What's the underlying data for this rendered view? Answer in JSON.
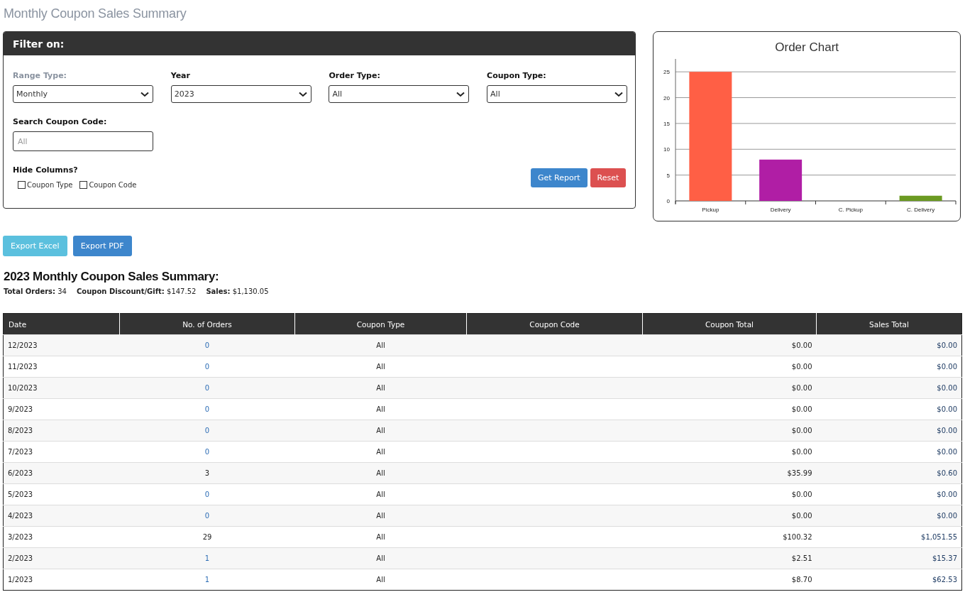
{
  "page_title": "Monthly Coupon Sales Summary",
  "filter": {
    "title": "Filter on:",
    "selects": [
      {
        "label": "Range Type:",
        "dimmed": true,
        "value": "Monthly"
      },
      {
        "label": "Year",
        "dimmed": false,
        "value": "2023"
      },
      {
        "label": "Order Type:",
        "dimmed": false,
        "value": "All"
      },
      {
        "label": "Coupon Type:",
        "dimmed": false,
        "value": "All"
      }
    ],
    "search": {
      "label": "Search Coupon Code:",
      "placeholder": "All"
    },
    "hide_columns": {
      "label": "Hide Columns?",
      "options": [
        {
          "label": "Coupon Type",
          "checked": false
        },
        {
          "label": "Coupon Code",
          "checked": false
        }
      ]
    },
    "buttons": [
      {
        "label": "Get Report",
        "kind": "primary"
      },
      {
        "label": "Reset",
        "kind": "danger"
      }
    ]
  },
  "chart": {
    "chart_data": {
      "type": "bar",
      "title": "Order Chart",
      "categories": [
        "Pickup",
        "Delivery",
        "C. Pickup",
        "C. Delivery"
      ],
      "series": [
        {
          "color": "#ff5f45",
          "values": [
            25,
            null,
            null,
            null
          ]
        },
        {
          "color": "#b01ea5",
          "values": [
            null,
            8,
            null,
            null
          ]
        },
        {
          "values": [
            null,
            null,
            0,
            null
          ]
        },
        {
          "color": "#6b9a22",
          "values": [
            null,
            null,
            null,
            1
          ]
        }
      ],
      "stacked": true,
      "grid": true,
      "ylim": [
        0,
        27.5
      ],
      "yticks": [
        0,
        5,
        10,
        15,
        20,
        25
      ]
    }
  },
  "export_buttons": [
    {
      "label": "Export Excel",
      "kind": "info"
    },
    {
      "label": "Export PDF",
      "kind": "primary"
    }
  ],
  "summary": {
    "heading": "2023 Monthly Coupon Sales Summary:",
    "stats": [
      {
        "label": "Total Orders:",
        "value": "34"
      },
      {
        "label": "Coupon Discount/Gift:",
        "value": "$147.52"
      },
      {
        "label": "Sales:",
        "value": "$1,130.05"
      }
    ]
  },
  "table": {
    "columns": [
      "Date",
      "No. of Orders",
      "Coupon Type",
      "Coupon Code",
      "Coupon Total",
      "Sales Total"
    ],
    "rows": [
      {
        "date": "12/2023",
        "orders": "0",
        "orders_link": true,
        "coupon_type": "All",
        "coupon_total": "$0.00",
        "sales_total": "$0.00"
      },
      {
        "date": "11/2023",
        "orders": "0",
        "orders_link": true,
        "coupon_type": "All",
        "coupon_total": "$0.00",
        "sales_total": "$0.00"
      },
      {
        "date": "10/2023",
        "orders": "0",
        "orders_link": true,
        "coupon_type": "All",
        "coupon_total": "$0.00",
        "sales_total": "$0.00"
      },
      {
        "date": "9/2023",
        "orders": "0",
        "orders_link": true,
        "coupon_type": "All",
        "coupon_total": "$0.00",
        "sales_total": "$0.00"
      },
      {
        "date": "8/2023",
        "orders": "0",
        "orders_link": true,
        "coupon_type": "All",
        "coupon_total": "$0.00",
        "sales_total": "$0.00"
      },
      {
        "date": "7/2023",
        "orders": "0",
        "orders_link": true,
        "coupon_type": "All",
        "coupon_total": "$0.00",
        "sales_total": "$0.00"
      },
      {
        "date": "6/2023",
        "orders": "3",
        "orders_link": false,
        "coupon_type": "All",
        "coupon_total": "$35.99",
        "sales_total": "$0.60"
      },
      {
        "date": "5/2023",
        "orders": "0",
        "orders_link": true,
        "coupon_type": "All",
        "coupon_total": "$0.00",
        "sales_total": "$0.00"
      },
      {
        "date": "4/2023",
        "orders": "0",
        "orders_link": true,
        "coupon_type": "All",
        "coupon_total": "$0.00",
        "sales_total": "$0.00"
      },
      {
        "date": "3/2023",
        "orders": "29",
        "orders_link": false,
        "coupon_type": "All",
        "coupon_total": "$100.32",
        "sales_total": "$1,051.55"
      },
      {
        "date": "2/2023",
        "orders": "1",
        "orders_link": true,
        "coupon_type": "All",
        "coupon_total": "$2.51",
        "sales_total": "$15.37"
      },
      {
        "date": "1/2023",
        "orders": "1",
        "orders_link": true,
        "coupon_type": "All",
        "coupon_total": "$8.70",
        "sales_total": "$62.53"
      }
    ]
  }
}
